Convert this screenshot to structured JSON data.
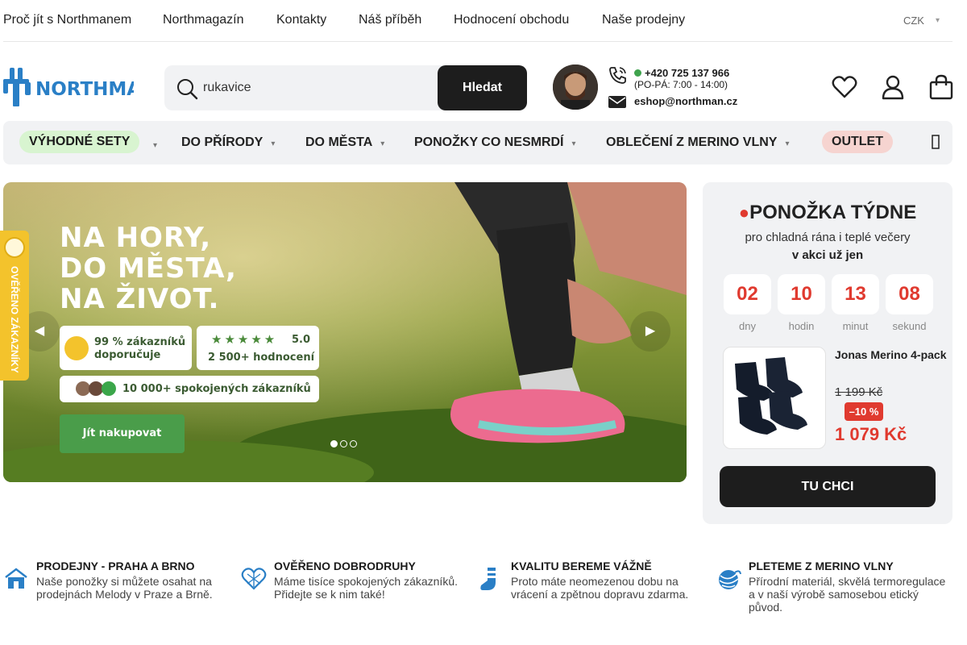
{
  "top_links": [
    "Proč jít s Northmanem",
    "Northmagazín",
    "Kontakty",
    "Náš příběh",
    "Hodnocení obchodu",
    "Naše prodejny"
  ],
  "currency": "CZK",
  "header": {
    "logo_text": "NORTHMAN",
    "search_value": "rukavice",
    "search_button": "Hledat",
    "phone": "+420 725 137 966",
    "hours": "(PO-PÁ: 7:00 - 14:00)",
    "email": "eshop@northman.cz"
  },
  "nav": {
    "items": [
      "VÝHODNÉ SETY",
      "DO PŘÍRODY",
      "DO MĚSTA",
      "PONOŽKY CO NESMRDÍ",
      "OBLEČENÍ Z MERINO VLNY",
      "OUTLET"
    ]
  },
  "banner": {
    "headline": [
      "NA HORY,",
      "DO MĚSTA,",
      "NA ŽIVOT."
    ],
    "badge1": "99 % zákazníků doporučuje",
    "badge2_rating": "5.0",
    "badge2_text": "2 500+ hodnocení",
    "badge3": "10 000+ spokojených zákazníků",
    "cta": "Jít nakupovat",
    "slides": 3,
    "active_slide": 1,
    "rating_stars": 5
  },
  "side_tab": "OVĚŘENO ZÁKAZNÍKY",
  "product_week": {
    "title": "PONOŽKA TÝDNE",
    "subtitle": "pro chladná rána i teplé večery",
    "subtitle2": "v akci už jen",
    "countdown": [
      {
        "value": "02",
        "label": "dny"
      },
      {
        "value": "10",
        "label": "hodin"
      },
      {
        "value": "13",
        "label": "minut"
      },
      {
        "value": "08",
        "label": "sekund"
      }
    ],
    "product_name": "Jonas Merino 4-pack",
    "old_price": "1 199 Kč",
    "discount": "–10 %",
    "new_price": "1 079 Kč",
    "button": "TU CHCI"
  },
  "benefits": [
    {
      "title": "PRODEJNY - PRAHA A BRNO",
      "text": "Naše ponožky si můžete osahat na prodejnách Melody v Praze a Brně.",
      "icon": "store-icon"
    },
    {
      "title": "OVĚŘENO DOBRODRUHY",
      "text": "Máme tisíce spokojených zákazníků. Přidejte se k nim také!",
      "icon": "heart-pattern-icon"
    },
    {
      "title": "KVALITU BEREME VÁŽNĚ",
      "text": "Proto máte neomezenou dobu na vrácení a zpětnou dopravu zdarma.",
      "icon": "sock-icon"
    },
    {
      "title": "PLETEME Z MERINO VLNY",
      "text": "Přírodní materiál, skvělá termoregulace a v naší výrobě samosebou etický původ.",
      "icon": "yarn-icon"
    }
  ],
  "colors": {
    "accent_red": "#e03a2f",
    "dark": "#1d1d1d",
    "brand_blue": "#2a7fc6",
    "green": "#4a9d4a",
    "yellow": "#f3c32c"
  }
}
